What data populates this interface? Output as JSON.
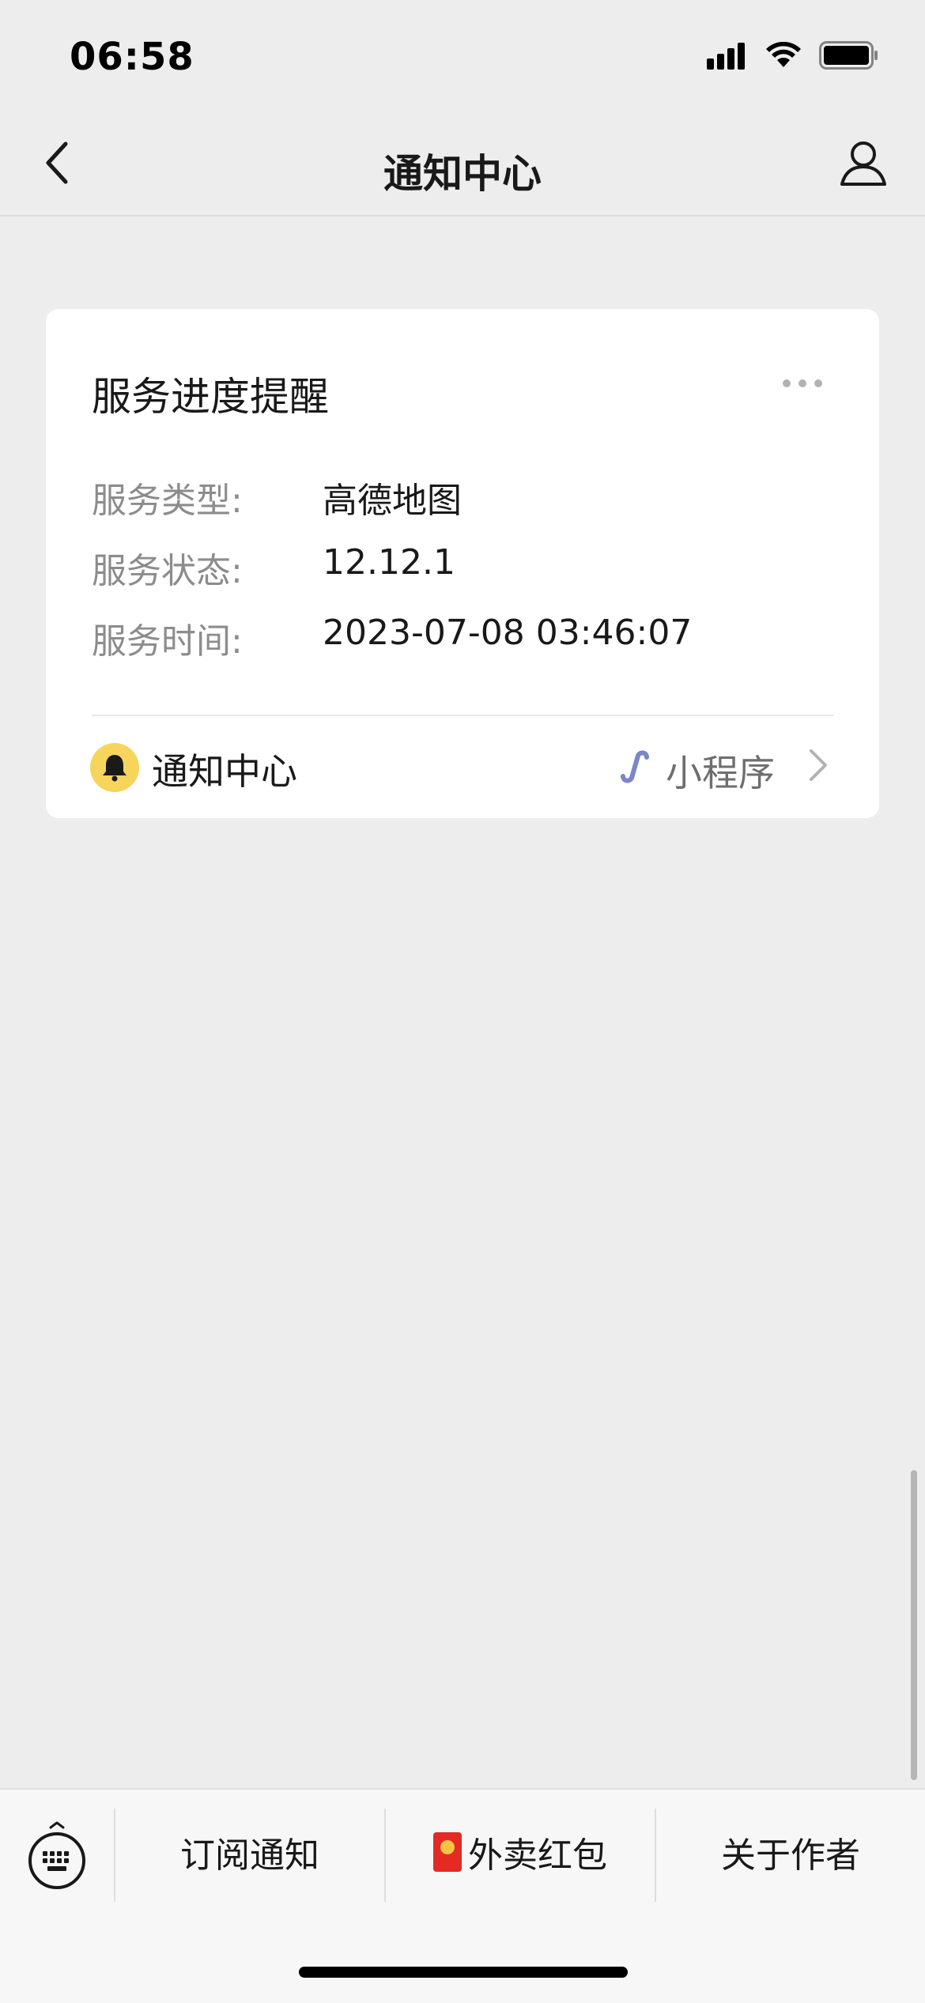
{
  "status_bar": {
    "time": "06:58"
  },
  "nav": {
    "title": "通知中心",
    "back_icon": "chevron-left-icon",
    "profile_icon": "person-icon"
  },
  "card": {
    "title": "服务进度提醒",
    "more_icon": "ellipsis-icon",
    "fields": [
      {
        "label": "服务类型:",
        "value": "高德地图"
      },
      {
        "label": "服务状态:",
        "value": "12.12.1"
      },
      {
        "label": "服务时间:",
        "value": "2023-07-08 03:46:07"
      }
    ],
    "source": {
      "name": "通知中心",
      "icon": "bell-icon",
      "icon_bg": "#f7d45c"
    },
    "mini_program": {
      "label": "小程序",
      "icon": "mini-program-link-icon",
      "icon_color": "#7b86c9"
    }
  },
  "bottom_menu": {
    "keyboard_icon": "keyboard-icon",
    "items": [
      {
        "label": "订阅通知"
      },
      {
        "label": "外卖红包",
        "icon": "red-packet-icon"
      },
      {
        "label": "关于作者"
      }
    ]
  },
  "colors": {
    "background": "#ededed",
    "card": "#ffffff",
    "secondary_text": "#8c8c8c"
  }
}
